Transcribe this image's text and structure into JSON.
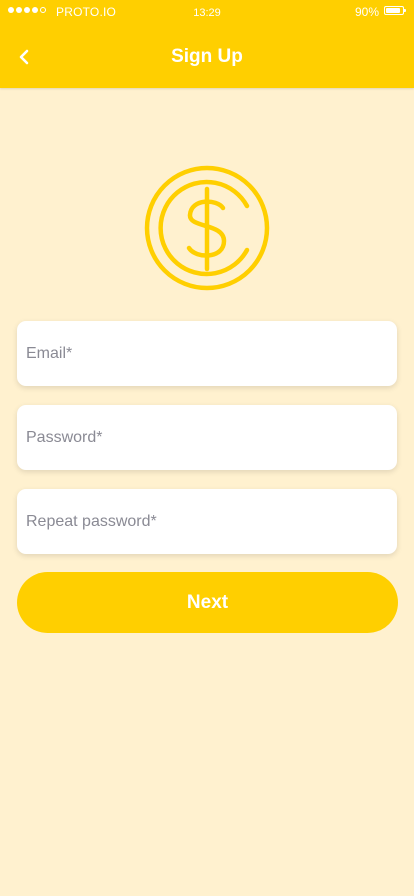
{
  "status_bar": {
    "carrier": "PROTO.IO",
    "time": "13:29",
    "battery": "90%",
    "battery_level": 0.9,
    "signal_bars_filled": 4,
    "signal_bars_total": 5
  },
  "header": {
    "title": "Sign Up",
    "back_icon": "chevron-left-icon"
  },
  "logo": {
    "icon": "dollar-coin-icon",
    "color": "#FFCF00"
  },
  "form": {
    "email_placeholder": "Email*",
    "password_placeholder": "Password*",
    "repeat_password_placeholder": "Repeat password*"
  },
  "actions": {
    "next_label": "Next"
  },
  "colors": {
    "accent": "#FFCF00",
    "background": "#FFF1CF",
    "placeholder": "#8A8A94"
  }
}
